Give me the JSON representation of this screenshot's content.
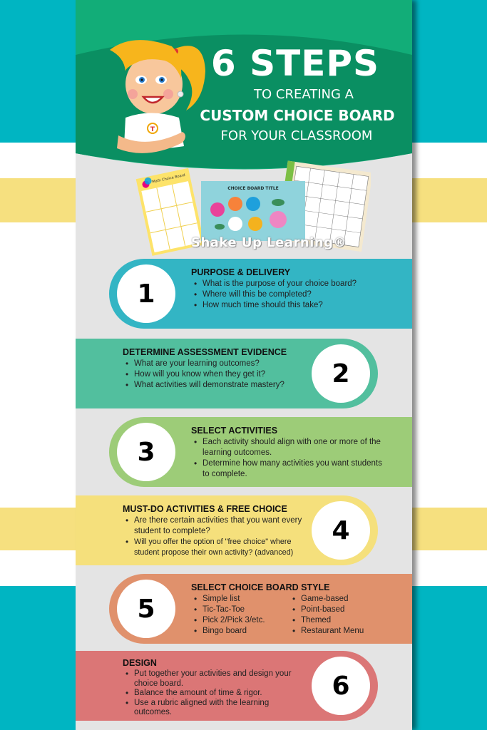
{
  "colors": {
    "background_teal": "#00b5c2",
    "background_yellow": "#f6e07f",
    "header_green_light": "#12ad78",
    "header_green_dark": "#0a8f62",
    "panel_gray": "#e4e4e4",
    "step_1": "#33b5c4",
    "step_2": "#52bf9e",
    "step_3": "#9dcc78",
    "step_4": "#f5e07c",
    "step_5": "#e0916c",
    "step_6": "#db7676"
  },
  "header": {
    "title_big": "6 STEPS",
    "line1": "TO CREATING A",
    "line2": "CUSTOM CHOICE BOARD",
    "line3": "FOR YOUR CLASSROOM"
  },
  "thumbnails": {
    "left_title": "Math Choice Board",
    "center_title": "CHOICE BOARD TITLE",
    "watermark": "Shake Up Learning®"
  },
  "steps": [
    {
      "number": "1",
      "title": "PURPOSE & DELIVERY",
      "bullets": [
        "What is the purpose of your choice board?",
        "Where will this be completed?",
        "How much time should this take?"
      ]
    },
    {
      "number": "2",
      "title": "DETERMINE ASSESSMENT EVIDENCE",
      "bullets": [
        "What are your learning outcomes?",
        "How will you know when they get it?",
        "What activities will demonstrate mastery?"
      ]
    },
    {
      "number": "3",
      "title": "SELECT ACTIVITIES",
      "bullets": [
        "Each activity should align with one or more of the learning outcomes.",
        "Determine how many activities you want students to complete."
      ]
    },
    {
      "number": "4",
      "title": "MUST-DO ACTIVITIES & FREE CHOICE",
      "bullets": [
        "Are there certain activities that you want every student to complete?",
        "Will you offer the option of \"free choice\" where student propose their own activity? (advanced)"
      ]
    },
    {
      "number": "5",
      "title": "SELECT CHOICE BOARD STYLE",
      "bullets_col1": [
        "Simple list",
        "Tic-Tac-Toe",
        "Pick 2/Pick 3/etc.",
        "Bingo board"
      ],
      "bullets_col2": [
        "Game-based",
        "Point-based",
        "Themed",
        "Restaurant Menu"
      ]
    },
    {
      "number": "6",
      "title": "DESIGN",
      "bullets": [
        "Put together your activities and design your choice board.",
        "Balance the amount of time & rigor.",
        "Use a rubric aligned with the learning outcomes."
      ]
    }
  ]
}
